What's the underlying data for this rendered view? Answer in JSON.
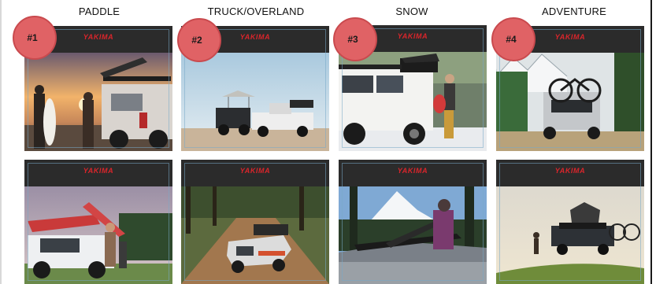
{
  "headings": {
    "paddle": "PADDLE",
    "truck": "TRUCK/OVERLAND",
    "snow": "SNOW",
    "adventure": "ADVENTURE"
  },
  "badges": [
    "#1",
    "#2",
    "#3",
    "#4"
  ],
  "brand": {
    "logo_text": "YAKIMA",
    "logo_color": "#d9252b",
    "badge_color": "#e06265"
  },
  "cards": [
    {
      "column": "PADDLE",
      "row": 1,
      "scene": "surfers-at-sunset-truck"
    },
    {
      "column": "TRUCK/OVERLAND",
      "row": 1,
      "scene": "trucks-in-desert-with-rooftop-tent"
    },
    {
      "column": "SNOW",
      "row": 1,
      "scene": "truck-with-cargo-box-in-snow"
    },
    {
      "column": "ADVENTURE",
      "row": 1,
      "scene": "suv-with-bike-rack-mountains"
    },
    {
      "column": "PADDLE",
      "row": 2,
      "scene": "suv-with-kayaks"
    },
    {
      "column": "TRUCK/OVERLAND",
      "row": 2,
      "scene": "truck-on-dirt-trail"
    },
    {
      "column": "SNOW",
      "row": 2,
      "scene": "skier-at-roof-rack-mountain"
    },
    {
      "column": "ADVENTURE",
      "row": 2,
      "scene": "truck-rooftop-tent-meadow"
    }
  ]
}
